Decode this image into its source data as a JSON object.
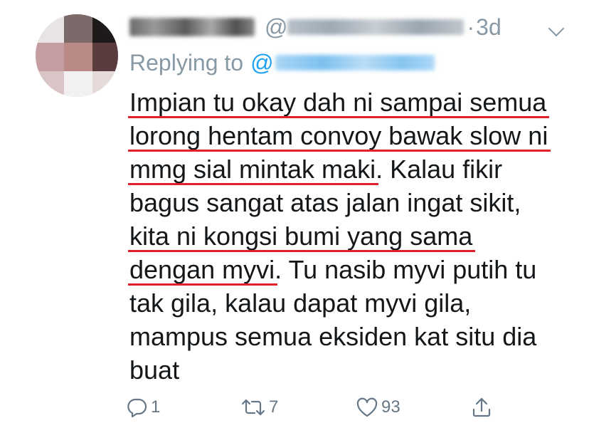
{
  "tweet": {
    "display_name": "",
    "at_prefix": "@",
    "separator": "·",
    "time": "3d",
    "replying_label": "Replying to",
    "replying_at": "@",
    "body_lines": [
      [
        {
          "text": "Impian tu okay dah ni sampai semua",
          "underline": true
        }
      ],
      [
        {
          "text": "lorong  hentam convoy bawak slow ni",
          "underline": true
        }
      ],
      [
        {
          "text": "mmg sial mintak maki",
          "underline": true
        },
        {
          "text": ". Kalau fikir",
          "underline": false
        }
      ],
      [
        {
          "text": "bagus sangat atas jalan ingat sikit,",
          "underline": false
        }
      ],
      [
        {
          "text": "kita ni kongsi bumi yang sama",
          "underline": true
        }
      ],
      [
        {
          "text": "dengan myvi",
          "underline": true
        },
        {
          "text": ". Tu nasib myvi putih tu",
          "underline": false
        }
      ],
      [
        {
          "text": "tak gila, kalau dapat myvi gila,",
          "underline": false
        }
      ],
      [
        {
          "text": "mampus semua eksiden kat situ dia",
          "underline": false
        }
      ],
      [
        {
          "text": "buat",
          "underline": false
        }
      ]
    ],
    "actions": {
      "reply_count": "1",
      "retweet_count": "7",
      "like_count": "93",
      "share_count": ""
    },
    "icons": {
      "reply": "reply-icon",
      "retweet": "retweet-icon",
      "like": "heart-icon",
      "share": "share-icon",
      "more": "chevron-down-icon"
    },
    "colors": {
      "meta_gray": "#8899a6",
      "link_blue": "#1da1f2",
      "underline_red": "#e0202b",
      "text": "#14171a"
    }
  }
}
